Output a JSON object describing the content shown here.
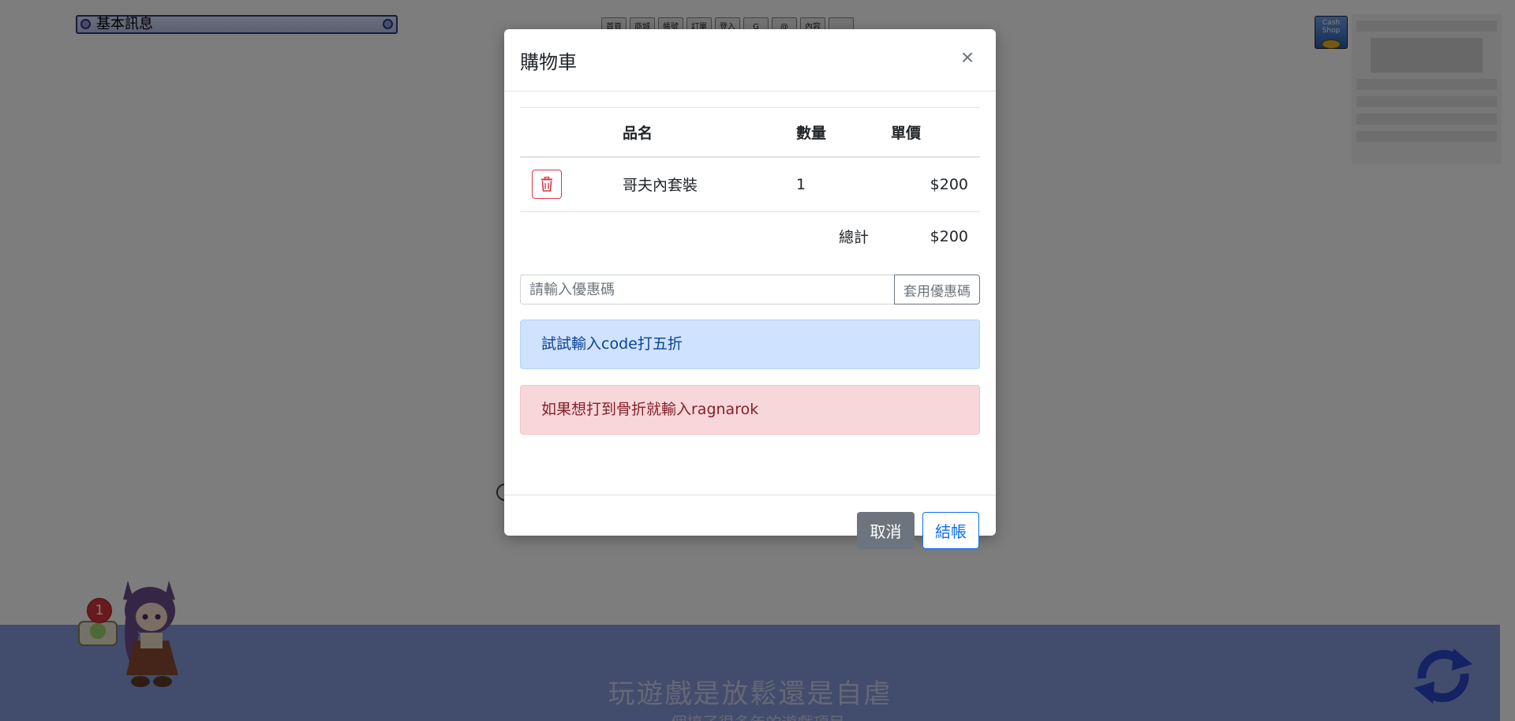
{
  "background": {
    "window_title": "基本訊息",
    "toolbar_buttons": [
      "首頁",
      "商城",
      "帳號",
      "訂單",
      "登入",
      "G",
      "@",
      "內容",
      ""
    ],
    "cash_shop_label": "Cash Shop",
    "notification_count": "1",
    "footer_title": "玩遊戲是放鬆還是自虐",
    "footer_subtitle": "一個搞了很多年的遊戲項目"
  },
  "modal": {
    "title": "購物車",
    "close_label": "×",
    "table": {
      "headers": [
        "",
        "品名",
        "數量",
        "單價"
      ],
      "items": [
        {
          "name": "哥夫內套裝",
          "quantity": "1",
          "price": "$200"
        }
      ],
      "total_label": "總計",
      "total_value": "$200"
    },
    "coupon": {
      "placeholder": "請輸入優惠碼",
      "value": "",
      "apply_label": "套用優惠碼"
    },
    "alerts": {
      "info": "試試輸入code打五折",
      "danger": "如果想打到骨折就輸入ragnarok"
    },
    "footer": {
      "cancel_label": "取消",
      "checkout_label": "結帳"
    }
  },
  "colors": {
    "backdrop": "rgba(0,0,0,0.5)",
    "danger": "#dc3545",
    "primary": "#0d6efd",
    "secondary": "#6c757d",
    "footer_band": "#8498d8"
  }
}
